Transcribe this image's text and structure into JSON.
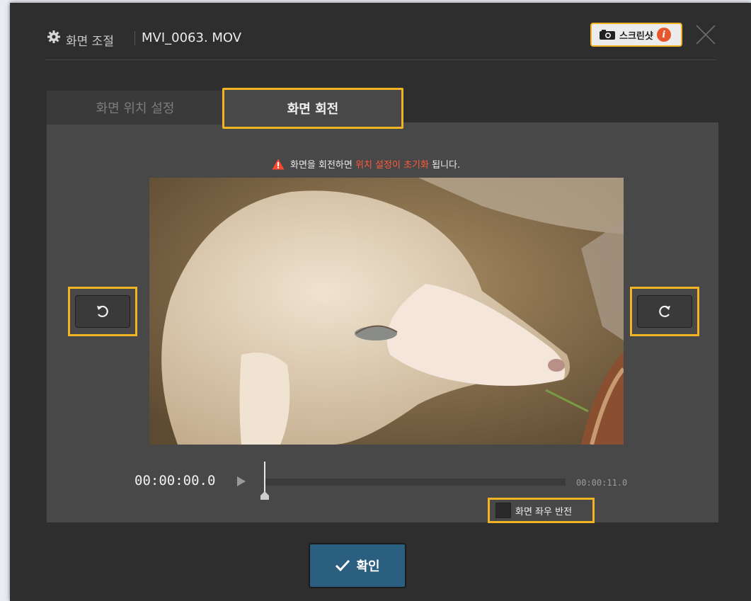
{
  "header": {
    "title": "화면 조절",
    "filename": "MVI_0063. MOV",
    "screenshot_label": "스크린샷",
    "screenshot_info": "i"
  },
  "tabs": [
    {
      "label": "화면 위치 설정",
      "active": false
    },
    {
      "label": "화면 회전",
      "active": true
    }
  ],
  "warning": {
    "prefix": "화면을 회전하면 ",
    "highlight": "위치 설정이 초기화",
    "suffix": " 됩니다."
  },
  "timeline": {
    "current_time": "00:00:00.0",
    "total_time": "00:00:11.0",
    "progress": 0
  },
  "flip": {
    "label": "화면 좌우 반전",
    "checked": false
  },
  "confirm": {
    "label": "확인"
  },
  "colors": {
    "highlight_border": "#f0b323",
    "warning_text": "#ff5a3c",
    "confirm_bg": "#2b5f80",
    "dialog_bg": "#2e2e2e",
    "panel_bg": "#484848"
  },
  "icons": [
    "gear-icon",
    "camera-icon",
    "info-icon",
    "close-icon",
    "warning-icon",
    "rotate-left-icon",
    "rotate-right-icon",
    "play-icon",
    "checkmark-icon"
  ]
}
